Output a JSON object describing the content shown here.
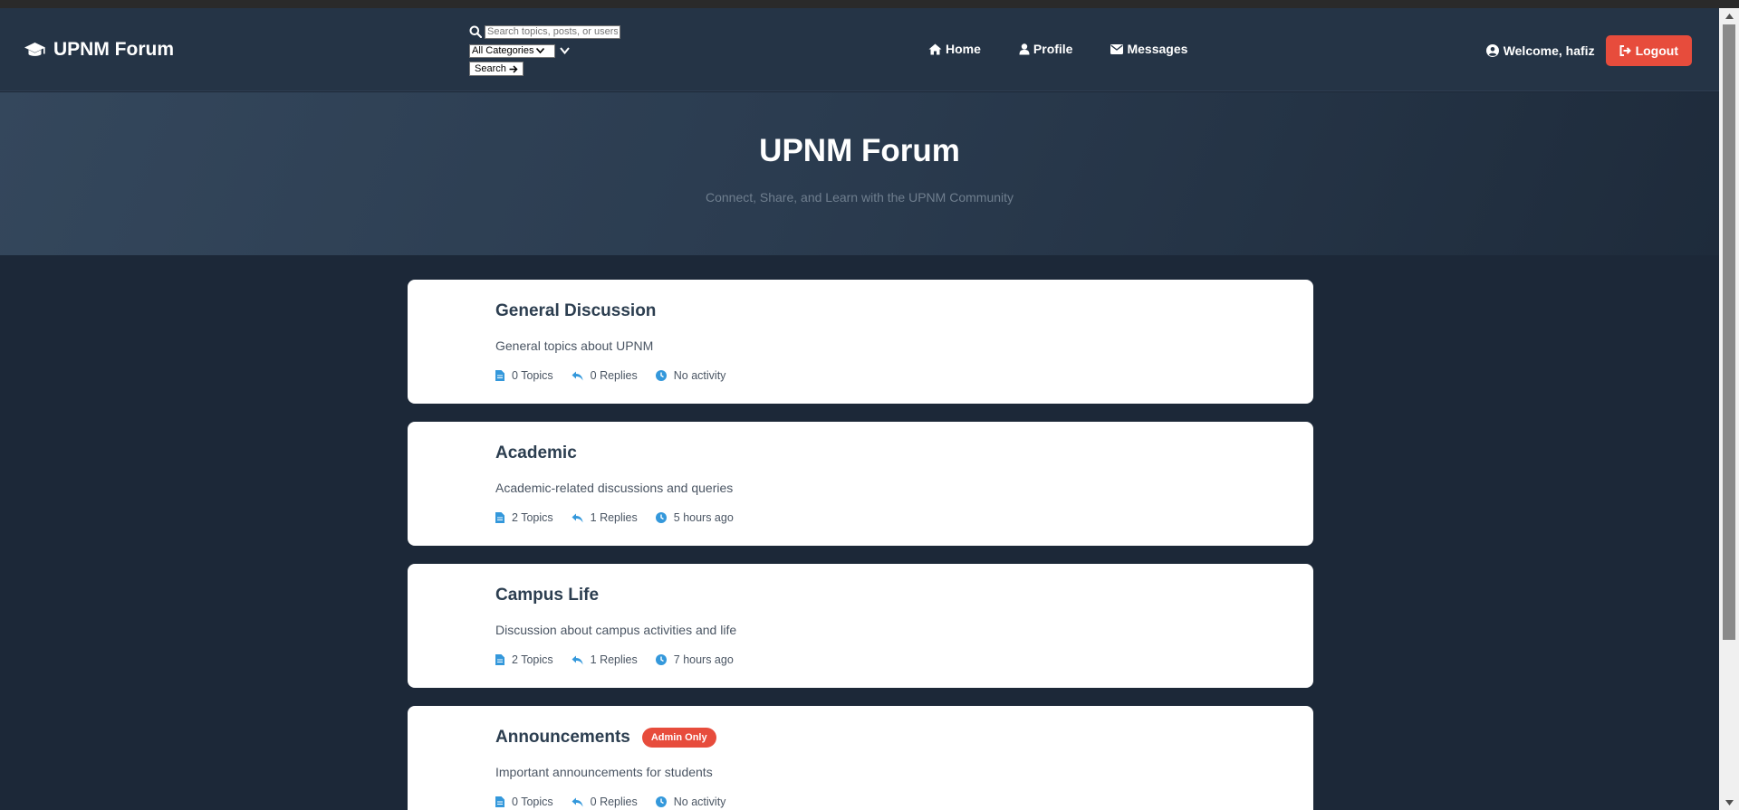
{
  "brand": {
    "title": "UPNM Forum"
  },
  "search": {
    "placeholder": "Search topics, posts, or users",
    "category_selected": "All Categories",
    "button_label": "Search"
  },
  "nav": {
    "home": "Home",
    "profile": "Profile",
    "messages": "Messages"
  },
  "user": {
    "welcome": "Welcome, hafiz",
    "logout": "Logout"
  },
  "hero": {
    "title": "UPNM Forum",
    "subtitle": "Connect, Share, and Learn with the UPNM Community"
  },
  "categories": [
    {
      "name": "General Discussion",
      "description": "General topics about UPNM",
      "topics": "0 Topics",
      "replies": "0 Replies",
      "activity": "No activity",
      "badge": ""
    },
    {
      "name": "Academic",
      "description": "Academic-related discussions and queries",
      "topics": "2 Topics",
      "replies": "1 Replies",
      "activity": "5 hours ago",
      "badge": ""
    },
    {
      "name": "Campus Life",
      "description": "Discussion about campus activities and life",
      "topics": "2 Topics",
      "replies": "1 Replies",
      "activity": "7 hours ago",
      "badge": ""
    },
    {
      "name": "Announcements",
      "description": "Important announcements for students",
      "topics": "0 Topics",
      "replies": "0 Replies",
      "activity": "No activity",
      "badge": "Admin Only"
    }
  ],
  "colors": {
    "accent": "#3498db",
    "danger": "#e74c3c",
    "navbar": "#253446",
    "background": "#1c2838"
  }
}
